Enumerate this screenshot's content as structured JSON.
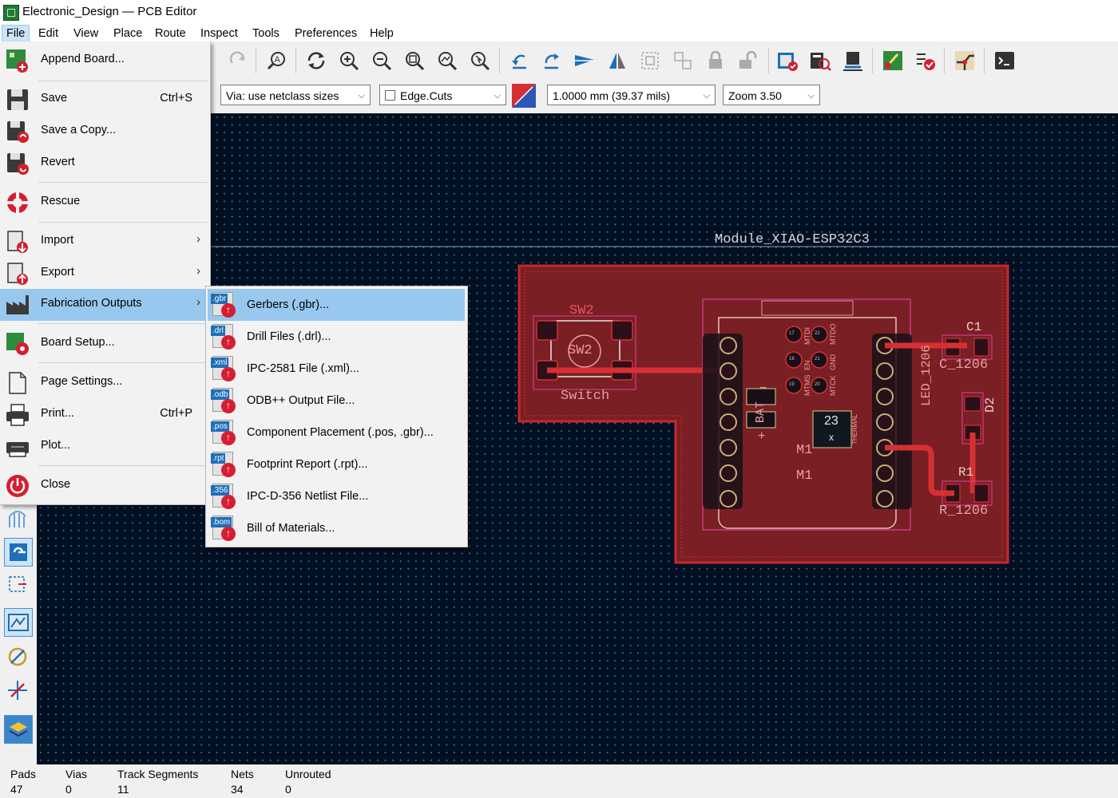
{
  "window": {
    "title": "Electronic_Design — PCB Editor"
  },
  "menubar": {
    "items": [
      {
        "label": "File",
        "x": 0
      },
      {
        "label": "Edit"
      },
      {
        "label": "View"
      },
      {
        "label": "Place"
      },
      {
        "label": "Route"
      },
      {
        "label": "Inspect"
      },
      {
        "label": "Tools"
      },
      {
        "label": "Preferences"
      },
      {
        "label": "Help"
      }
    ]
  },
  "toolbar2": {
    "via": "Via: use netclass sizes",
    "layer": "Edge.Cuts",
    "grid": "1.0000 mm (39.37 mils)",
    "zoom": "Zoom 3.50"
  },
  "file_menu": {
    "append_board": "Append Board...",
    "save": "Save",
    "save_shortcut": "Ctrl+S",
    "save_copy": "Save a Copy...",
    "revert": "Revert",
    "rescue": "Rescue",
    "import": "Import",
    "export": "Export",
    "fabrication_outputs": "Fabrication Outputs",
    "board_setup": "Board Setup...",
    "page_settings": "Page Settings...",
    "print": "Print...",
    "print_shortcut": "Ctrl+P",
    "plot": "Plot...",
    "close": "Close"
  },
  "fab_submenu": {
    "items": [
      {
        "ext": ".gbr",
        "label": "Gerbers (.gbr)..."
      },
      {
        "ext": ".drl",
        "label": "Drill Files (.drl)..."
      },
      {
        "ext": ".xml",
        "label": "IPC-2581 File (.xml)..."
      },
      {
        "ext": ".odb",
        "label": "ODB++ Output File..."
      },
      {
        "ext": ".pos",
        "label": "Component Placement (.pos, .gbr)..."
      },
      {
        "ext": ".rpt",
        "label": "Footprint Report (.rpt)..."
      },
      {
        "ext": ".356",
        "label": "IPC-D-356 Netlist File..."
      },
      {
        "ext": ".bom",
        "label": "Bill of Materials..."
      }
    ]
  },
  "pcb": {
    "module_label": "Module_XIAO-ESP32C3",
    "sw2_ref": "SW2",
    "sw2_inner": "SW2",
    "switch_label": "Switch",
    "c1_ref": "C1",
    "c1_value": "C_1206",
    "led_value": "LED_1206",
    "d2_ref": "D2",
    "r1_ref": "R1",
    "r1_value": "R_1206",
    "m1_ref": "M1",
    "m1_value": "M1",
    "bat_label": "BAT",
    "thermal_label": "THERMAL",
    "pad23": "23",
    "pad23x": "x",
    "bat_minus": "−",
    "bat_plus": "+",
    "pad_labels": [
      "17",
      "22",
      "18",
      "21",
      "19",
      "20"
    ],
    "pin_labels": [
      "MTDO",
      "GND",
      "MTCK",
      "MTMS",
      "EN",
      "MTDI"
    ]
  },
  "status": {
    "pads_label": "Pads",
    "pads": "47",
    "vias_label": "Vias",
    "vias": "0",
    "tracks_label": "Track Segments",
    "tracks": "11",
    "nets_label": "Nets",
    "nets": "34",
    "unrouted_label": "Unrouted",
    "unrouted": "0"
  },
  "colors": {
    "canvas_bg": "#001023",
    "board_fill": "#7a1f24",
    "edge_cuts": "#c8282d",
    "track": "#d63033",
    "silkscreen": "#e8e8e8",
    "courtyard": "#e040a0",
    "menu_highlight": "#99c8ee"
  }
}
